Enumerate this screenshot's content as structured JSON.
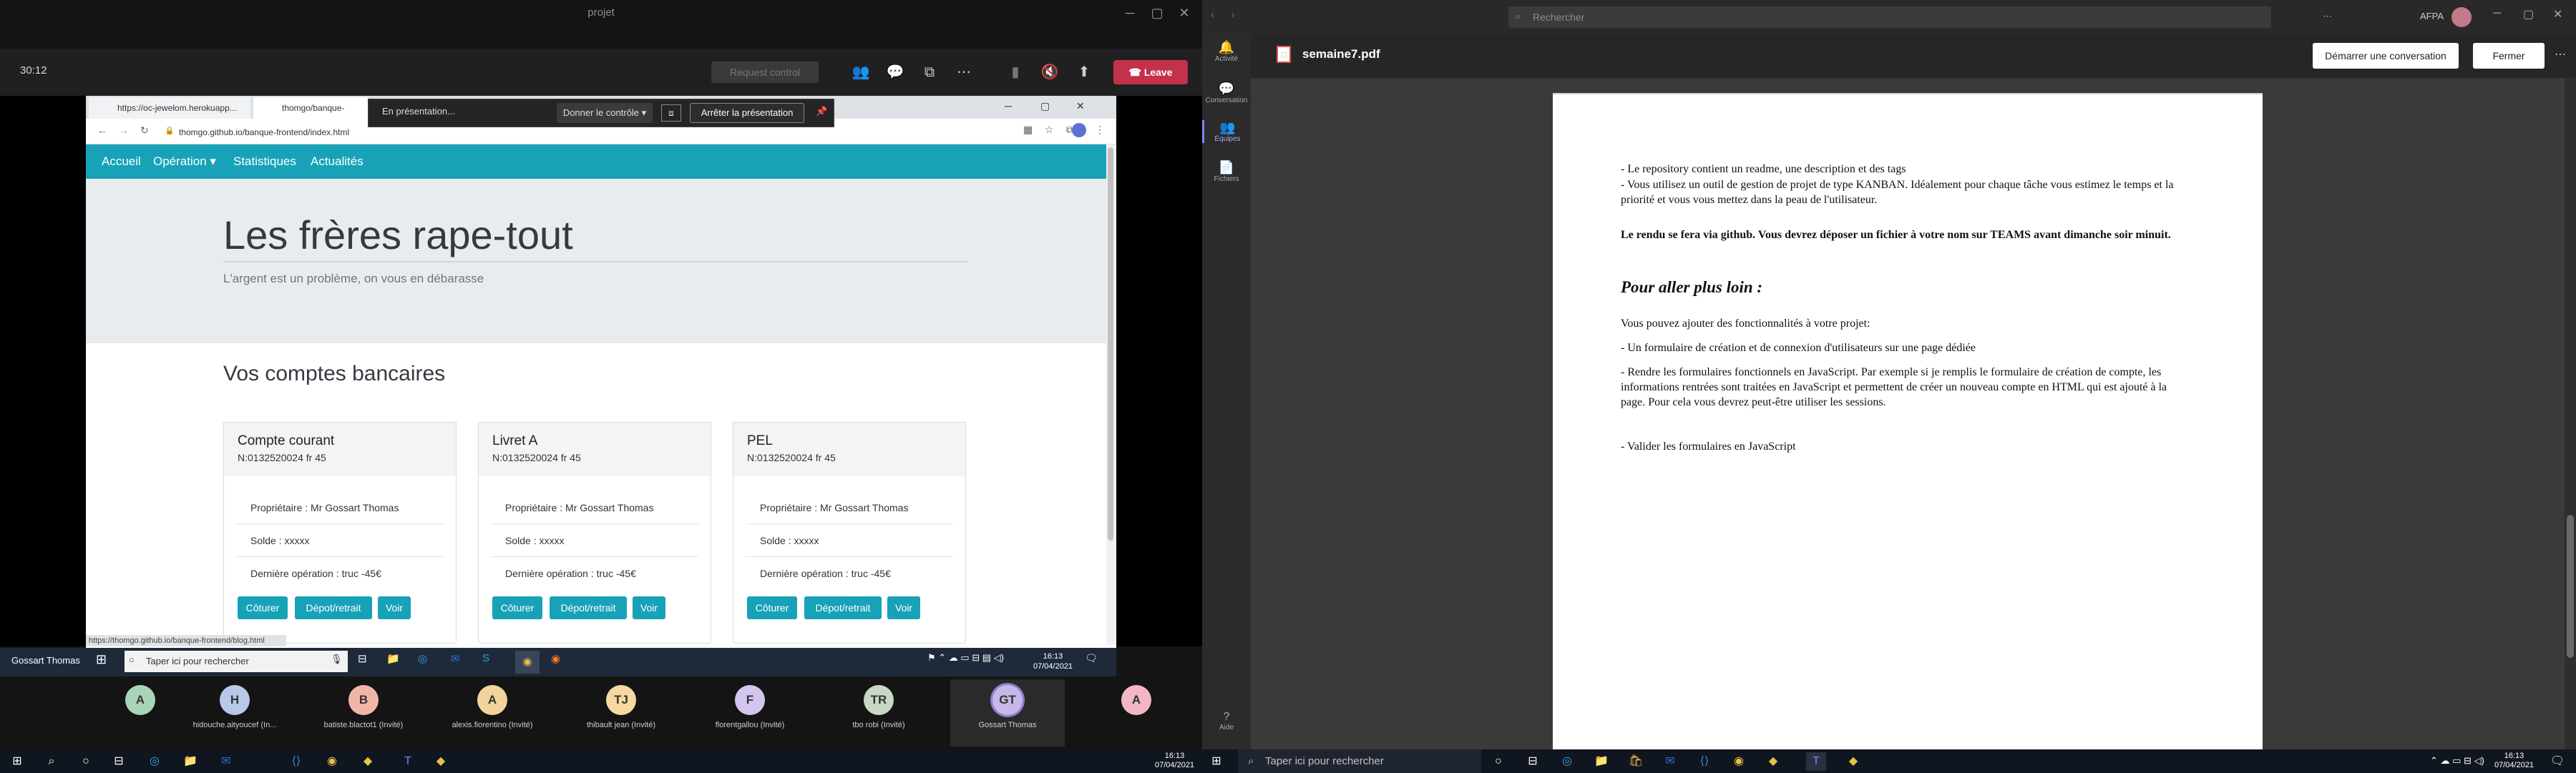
{
  "meeting": {
    "window_title": "projet",
    "timer": "30:12",
    "request_control": "Request control",
    "leave": "Leave",
    "presenting": "En présentation...",
    "give_control": "Donner le contrôle",
    "stop_presenting": "Arrêter la présentation"
  },
  "browser": {
    "tabs": [
      "https://oc-jewelom.herokuapp...",
      "thomgo/banque-frontend..."
    ],
    "url": "thomgo.github.io/banque-frontend/index.html",
    "status_url": "https://thomgo.github.io/banque-frontend/blog.html"
  },
  "site": {
    "nav": [
      "Accueil",
      "Opération ▾",
      "Statistiques",
      "Actualités"
    ],
    "title": "Les frères rape-tout",
    "subtitle": "L'argent est un problème, on vous en débarasse",
    "accounts_title": "Vos comptes bancaires",
    "cards": [
      {
        "name": "Compte courant",
        "number": "N:0132520024 fr 45",
        "owner": "Propriétaire : Mr Gossart Thomas",
        "balance": "Solde : xxxxx",
        "last_op": "Dernière opération : truc -45€",
        "b1": "Côturer",
        "b2": "Dépot/retrait",
        "b3": "Voir"
      },
      {
        "name": "Livret A",
        "number": "N:0132520024 fr 45",
        "owner": "Propriétaire : Mr Gossart Thomas",
        "balance": "Solde : xxxxx",
        "last_op": "Dernière opération : truc -45€",
        "b1": "Côturer",
        "b2": "Dépot/retrait",
        "b3": "Voir"
      },
      {
        "name": "PEL",
        "number": "N:0132520024 fr 45",
        "owner": "Propriétaire : Mr Gossart Thomas",
        "balance": "Solde : xxxxx",
        "last_op": "Dernière opération : truc -45€",
        "b1": "Côturer",
        "b2": "Dépot/retrait",
        "b3": "Voir"
      }
    ]
  },
  "inner_taskbar": {
    "user": "Gossart Thomas",
    "search": "Taper ici pour rechercher",
    "time": "16:13",
    "date": "07/04/2021"
  },
  "participants": [
    {
      "initials": "A",
      "name": "",
      "color": "#a8d5ba"
    },
    {
      "initials": "H",
      "name": "hidouche.aityoucef (In...",
      "color": "#b9c7e8"
    },
    {
      "initials": "B",
      "name": "batiste.blactot1 (Invité)",
      "color": "#f1b5a8"
    },
    {
      "initials": "A",
      "name": "alexis.fiorentino (Invité)",
      "color": "#f2d49a"
    },
    {
      "initials": "TJ",
      "name": "thibault jean (Invité)",
      "color": "#f5d9a0"
    },
    {
      "initials": "F",
      "name": "florentgallou (Invité)",
      "color": "#d3c5ee"
    },
    {
      "initials": "TR",
      "name": "tbo robi (Invité)",
      "color": "#c9d8c5"
    },
    {
      "initials": "GT",
      "name": "Gossart Thomas",
      "color": "#c8b8e8"
    },
    {
      "initials": "A",
      "name": "",
      "color": "#f2b6c4"
    }
  ],
  "teams": {
    "search": "Rechercher",
    "org": "AFPA",
    "rail": [
      "Activité",
      "Conversation",
      "Équipes",
      "Fichiers",
      "Aide"
    ],
    "pdf_title": "semaine7.pdf",
    "start_conversation": "Démarrer une conversation",
    "close": "Fermer"
  },
  "pdf": {
    "l1": "- Le repository contient un readme, une description et des tags",
    "l2": "- Vous utilisez un outil de gestion de projet de type KANBAN. Idéalement pour chaque tâche vous estimez le temps et la priorité et vous vous mettez dans la peau de l'utilisateur.",
    "l3": "Le rendu se fera via github. Vous devrez déposer un fichier à votre nom sur TEAMS avant dimanche soir minuit.",
    "h": "Pour aller plus loin :",
    "l4": "Vous pouvez ajouter des fonctionnalités à votre projet:",
    "l5": "- Un formulaire de création et de connexion d'utilisateurs sur une page dédiée",
    "l6": "- Rendre les formulaires fonctionnels en JavaScript. Par exemple si je remplis le formulaire de création de compte, les informations rentrées sont traitées en JavaScript et permettent de créer un nouveau compte en HTML qui est ajouté à la page. Pour cela vous devrez peut-être utiliser les sessions.",
    "l7": "- Valider les formulaires en JavaScript"
  },
  "taskbar": {
    "search": "Taper ici pour rechercher",
    "time": "16:13",
    "date": "07/04/2021"
  }
}
